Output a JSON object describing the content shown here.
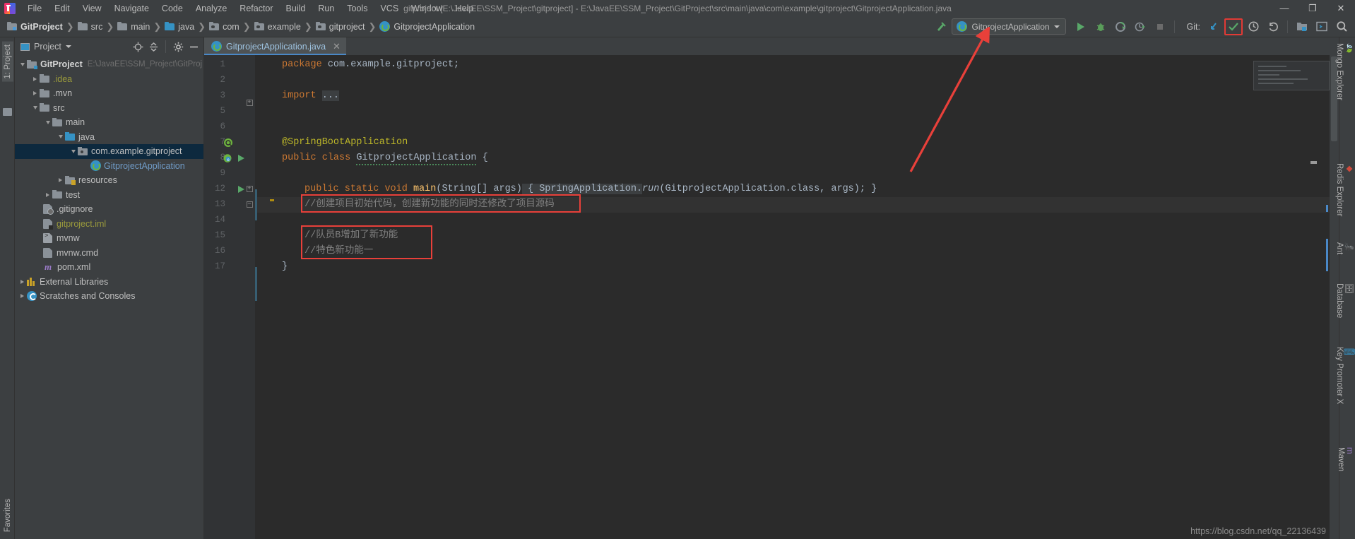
{
  "window": {
    "title": "gitproject [E:\\JavaEE\\SSM_Project\\gitproject] - E:\\JavaEE\\SSM_Project\\GitProject\\src\\main\\java\\com\\example\\gitproject\\GitprojectApplication.java",
    "minimize": "—",
    "maximize": "❐",
    "close": "✕"
  },
  "menu": {
    "items": [
      {
        "label": "File"
      },
      {
        "label": "Edit"
      },
      {
        "label": "View"
      },
      {
        "label": "Navigate"
      },
      {
        "label": "Code"
      },
      {
        "label": "Analyze"
      },
      {
        "label": "Refactor"
      },
      {
        "label": "Build"
      },
      {
        "label": "Run"
      },
      {
        "label": "Tools"
      },
      {
        "label": "VCS"
      },
      {
        "label": "Window"
      },
      {
        "label": "Help"
      }
    ]
  },
  "breadcrumb": {
    "items": [
      {
        "label": "GitProject",
        "icon": "module-folder-icon"
      },
      {
        "label": "src",
        "icon": "folder-icon"
      },
      {
        "label": "main",
        "icon": "folder-icon"
      },
      {
        "label": "java",
        "icon": "source-folder-icon"
      },
      {
        "label": "com",
        "icon": "package-icon"
      },
      {
        "label": "example",
        "icon": "package-icon"
      },
      {
        "label": "gitproject",
        "icon": "package-icon"
      },
      {
        "label": "GitprojectApplication",
        "icon": "spring-class-icon"
      }
    ]
  },
  "toolbar": {
    "run_config_label": "GitprojectApplication",
    "git_label": "Git:",
    "buttons": [
      {
        "name": "run-button",
        "title": "Run"
      },
      {
        "name": "debug-button",
        "title": "Debug"
      },
      {
        "name": "run-coverage-button",
        "title": "Run with Coverage"
      },
      {
        "name": "profile-button",
        "title": "Profile"
      },
      {
        "name": "stop-button",
        "title": "Stop"
      },
      {
        "name": "git-update-button",
        "title": "Update Project"
      },
      {
        "name": "git-commit-button",
        "title": "Commit"
      },
      {
        "name": "git-history-button",
        "title": "History"
      },
      {
        "name": "git-rollback-button",
        "title": "Rollback"
      },
      {
        "name": "select-opened-file-button",
        "title": "Select Opened File"
      },
      {
        "name": "terminal-button",
        "title": "Terminal"
      },
      {
        "name": "search-everywhere-button",
        "title": "Search Everywhere"
      }
    ]
  },
  "project_pane": {
    "title": "Project",
    "tree": [
      {
        "label": "GitProject",
        "path": "E:\\JavaEE\\SSM_Project\\GitProj",
        "indent": 0,
        "state": "expanded",
        "icon": "module-icon",
        "style": "bold",
        "selected": false
      },
      {
        "label": ".idea",
        "indent": 1,
        "state": "collapsed",
        "icon": "folder-icon",
        "style": "yellow",
        "selected": false
      },
      {
        "label": ".mvn",
        "indent": 1,
        "state": "collapsed",
        "icon": "folder-icon",
        "style": "normal",
        "selected": false
      },
      {
        "label": "src",
        "indent": 1,
        "state": "expanded",
        "icon": "folder-icon",
        "style": "normal",
        "selected": false
      },
      {
        "label": "main",
        "indent": 2,
        "state": "expanded",
        "icon": "folder-icon",
        "style": "normal",
        "selected": false
      },
      {
        "label": "java",
        "indent": 3,
        "state": "expanded",
        "icon": "source-folder-icon",
        "style": "normal",
        "selected": false
      },
      {
        "label": "com.example.gitproject",
        "indent": 4,
        "state": "expanded",
        "icon": "package-icon",
        "style": "normal",
        "selected": true
      },
      {
        "label": "GitprojectApplication",
        "indent": 5,
        "state": "leaf",
        "icon": "spring-class-icon",
        "style": "blue",
        "selected": false
      },
      {
        "label": "resources",
        "indent": 3,
        "state": "collapsed",
        "icon": "resources-folder-icon",
        "style": "normal",
        "selected": false
      },
      {
        "label": "test",
        "indent": 2,
        "state": "collapsed",
        "icon": "folder-icon",
        "style": "normal",
        "selected": false
      },
      {
        "label": ".gitignore",
        "indent": 2,
        "state": "leaf",
        "icon": "gitignore-file-icon",
        "style": "normal",
        "selected": false
      },
      {
        "label": "gitproject.iml",
        "indent": 2,
        "state": "leaf",
        "icon": "iml-file-icon",
        "style": "yellow",
        "selected": false
      },
      {
        "label": "mvnw",
        "indent": 2,
        "state": "leaf",
        "icon": "script-file-icon",
        "style": "normal",
        "selected": false
      },
      {
        "label": "mvnw.cmd",
        "indent": 2,
        "state": "leaf",
        "icon": "cmd-file-icon",
        "style": "normal",
        "selected": false
      },
      {
        "label": "pom.xml",
        "indent": 2,
        "state": "leaf",
        "icon": "maven-file-icon",
        "style": "normal",
        "selected": false
      },
      {
        "label": "External Libraries",
        "indent": 0,
        "state": "collapsed",
        "icon": "libraries-icon",
        "style": "normal",
        "selected": false
      },
      {
        "label": "Scratches and Consoles",
        "indent": 0,
        "state": "collapsed",
        "icon": "scratches-icon",
        "style": "normal",
        "selected": false
      }
    ]
  },
  "left_strip": {
    "project_tab": "1: Project",
    "favorites_tab": "Favorites"
  },
  "right_strip": {
    "tabs": [
      {
        "label": "Mongo Explorer"
      },
      {
        "label": "Redis Explorer"
      },
      {
        "label": "Ant"
      },
      {
        "label": "Database"
      },
      {
        "label": "Key Promoter X"
      },
      {
        "label": "Maven"
      }
    ]
  },
  "editor": {
    "tab": {
      "label": "GitprojectApplication.java",
      "close": "✕"
    },
    "lines": [
      {
        "num": "1",
        "text": "package com.example.gitproject;"
      },
      {
        "num": "2",
        "text": ""
      },
      {
        "num": "3",
        "text": "import ..."
      },
      {
        "num": "5",
        "text": ""
      },
      {
        "num": "6",
        "text": "@SpringBootApplication"
      },
      {
        "num": "7",
        "text": "public class GitprojectApplication {"
      },
      {
        "num": "8",
        "text": ""
      },
      {
        "num": "9",
        "text": "public static void main(String[] args) { SpringApplication.run(GitprojectApplication.class, args); }"
      },
      {
        "num": "12",
        "text": "//创建项目初始代码，创建新功能的同时还修改了项目源码"
      },
      {
        "num": "13",
        "text": ""
      },
      {
        "num": "14",
        "text": "//队员B增加了新功能"
      },
      {
        "num": "15",
        "text": "//特色新功能一"
      },
      {
        "num": "16",
        "text": "}"
      },
      {
        "num": "17",
        "text": ""
      }
    ],
    "tokens": {
      "kw_package": "package",
      "pkg_name": " com.example.gitproject;",
      "kw_import": "import",
      "import_fold": "...",
      "annotation": "@SpringBootApplication",
      "kw_public": "public",
      "kw_class": "class",
      "class_name": "GitprojectApplication",
      "brace_open": "{",
      "kw_static": "static",
      "kw_void": "void",
      "method_name": "main",
      "args_sig": "(String[] args)",
      "method_body": " { SpringApplication.",
      "run_call": "run",
      "run_args": "(GitprojectApplication.class, args); }",
      "comment1": "//创建项目初始代码，创建新功能的同时还修改了项目源码",
      "comment2": "//队员B增加了新功能",
      "comment3": "//特色新功能一",
      "brace_close": "}"
    }
  },
  "watermark": {
    "url": "https://blog.csdn.net/qq_22136439"
  },
  "colors": {
    "accent": "#4a88c7",
    "highlight_red": "#e8403a",
    "green": "#59a869",
    "keyword_orange": "#cc7832",
    "annotation_yellow": "#bbb529",
    "comment_gray": "#808080",
    "selection_blue": "#0d293e"
  }
}
